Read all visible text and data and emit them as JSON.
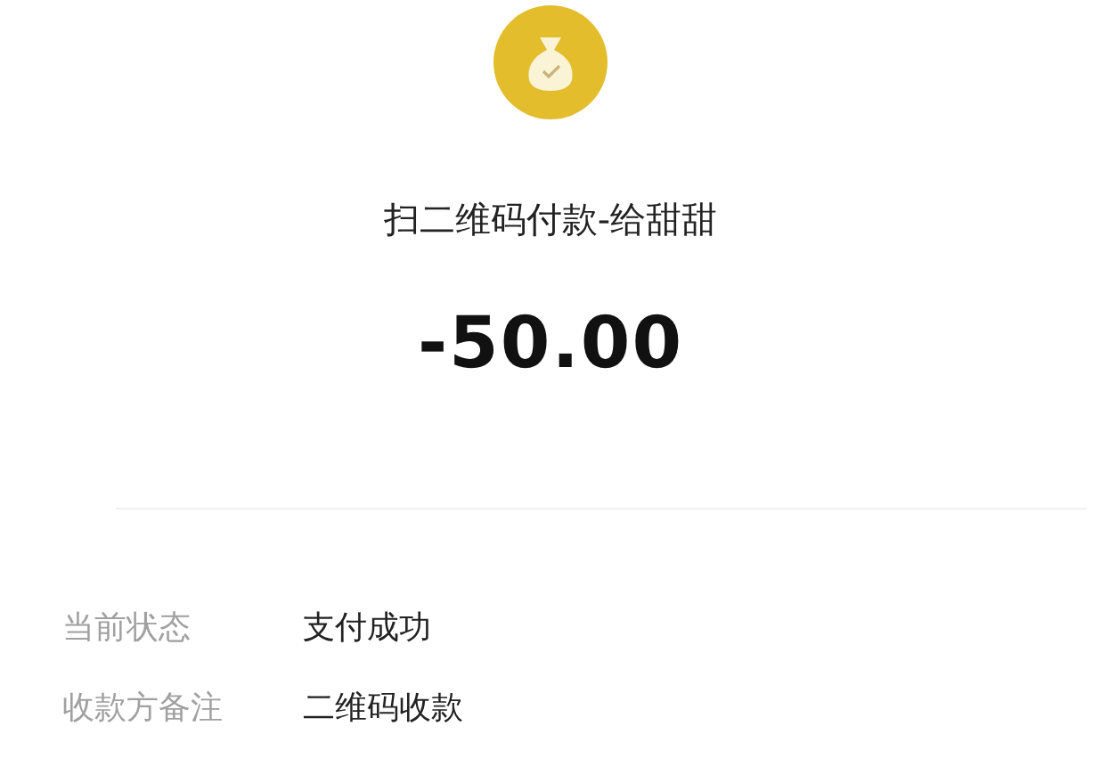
{
  "title": "扫二维码付款-给甜甜",
  "amount": "-50.00",
  "details": [
    {
      "label": "当前状态",
      "value": "支付成功"
    },
    {
      "label": "收款方备注",
      "value": "二维码收款"
    }
  ]
}
